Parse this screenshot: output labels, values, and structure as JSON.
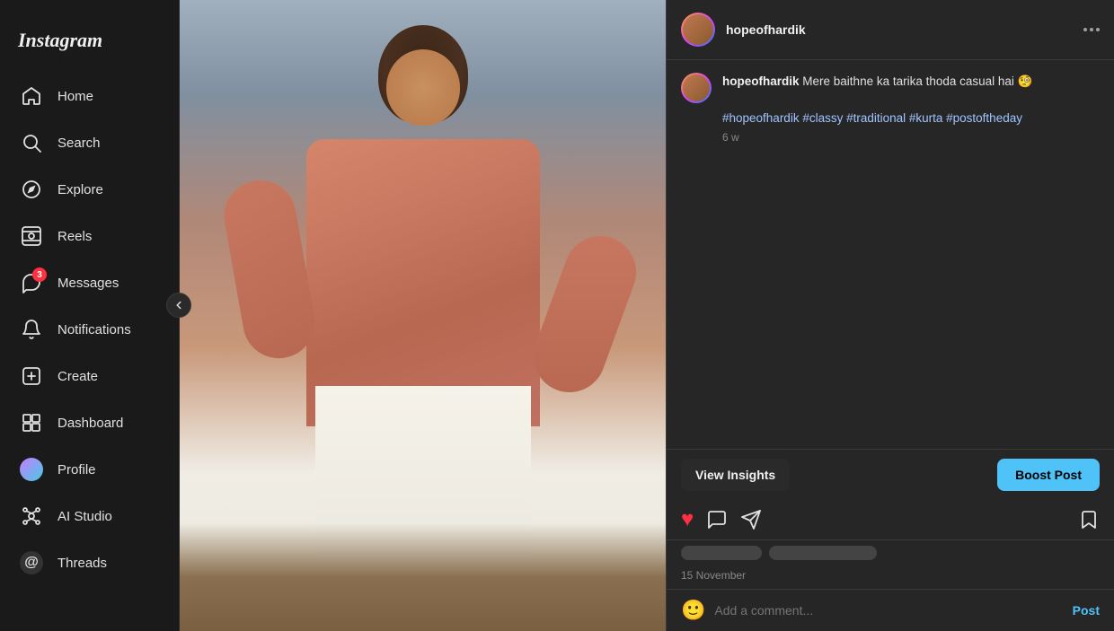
{
  "app": {
    "name": "Instagram"
  },
  "sidebar": {
    "items": [
      {
        "id": "home",
        "label": "Home",
        "icon": "home-icon"
      },
      {
        "id": "search",
        "label": "Search",
        "icon": "search-icon"
      },
      {
        "id": "explore",
        "label": "Explore",
        "icon": "explore-icon"
      },
      {
        "id": "reels",
        "label": "Reels",
        "icon": "reels-icon"
      },
      {
        "id": "messages",
        "label": "Messages",
        "icon": "messages-icon",
        "badge": "3"
      },
      {
        "id": "notifications",
        "label": "Notifications",
        "icon": "notifications-icon"
      },
      {
        "id": "create",
        "label": "Create",
        "icon": "create-icon"
      },
      {
        "id": "dashboard",
        "label": "Dashboard",
        "icon": "dashboard-icon"
      },
      {
        "id": "profile",
        "label": "Profile",
        "icon": "profile-icon"
      },
      {
        "id": "ai-studio",
        "label": "AI Studio",
        "icon": "ai-studio-icon"
      },
      {
        "id": "threads",
        "label": "Threads",
        "icon": "threads-icon"
      }
    ]
  },
  "post": {
    "username": "hopeofhardik",
    "header_username": "hopeofhardik",
    "comment_text": "Mere baithne ka tarika thoda casual hai 🧐",
    "hashtags": "#hopeofhardik #classy #traditional #kurta #postoftheday",
    "time_ago": "6 w",
    "date": "15 November",
    "comment_placeholder": "Add a comment...",
    "post_button": "Post",
    "view_insights": "View Insights",
    "boost_post": "Boost Post"
  }
}
